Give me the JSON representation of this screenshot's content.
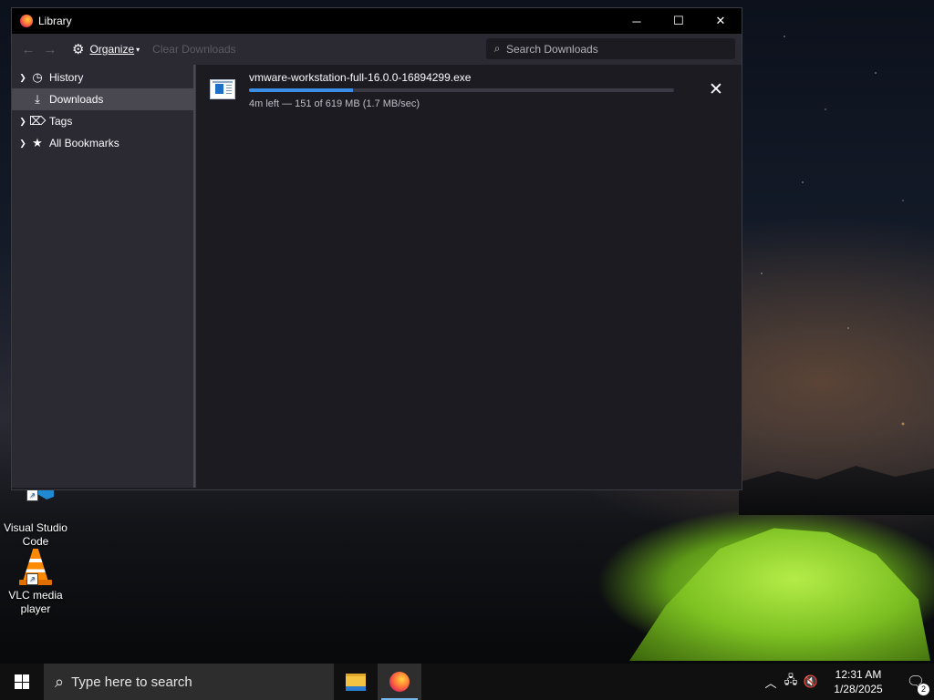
{
  "window": {
    "title": "Library",
    "controls": {
      "minimize": "─",
      "maximize": "☐",
      "close": "✕"
    }
  },
  "toolbar": {
    "back_icon": "←",
    "forward_icon": "→",
    "organize_label": "Organize",
    "clear_label": "Clear Downloads",
    "search_placeholder": "Search Downloads"
  },
  "sidebar": {
    "items": [
      {
        "label": "History",
        "icon": "clock-icon",
        "expandable": true
      },
      {
        "label": "Downloads",
        "icon": "download-icon",
        "expandable": false,
        "selected": true
      },
      {
        "label": "Tags",
        "icon": "tag-icon",
        "expandable": true
      },
      {
        "label": "All Bookmarks",
        "icon": "star-icon",
        "expandable": true
      }
    ]
  },
  "downloads": [
    {
      "filename": "vmware-workstation-full-16.0.0-16894299.exe",
      "status": "4m left — 151 of 619 MB (1.7 MB/sec)",
      "progress_fraction": 0.244
    }
  ],
  "desktop": {
    "icons": [
      {
        "label": "Visual Studio Code",
        "line1": "Visual Studio",
        "line2": "Code"
      },
      {
        "label": "VLC media player",
        "line1": "VLC media",
        "line2": "player"
      }
    ]
  },
  "taskbar": {
    "search_placeholder": "Type here to search",
    "apps": [
      "file-explorer",
      "firefox"
    ],
    "time": "12:31 AM",
    "date": "1/28/2025",
    "notification_count": "2"
  },
  "colors": {
    "accent": "#3a8ee6",
    "window_bg": "#1c1b22",
    "sidebar_bg": "#2b2a33",
    "selected_bg": "#494850"
  }
}
